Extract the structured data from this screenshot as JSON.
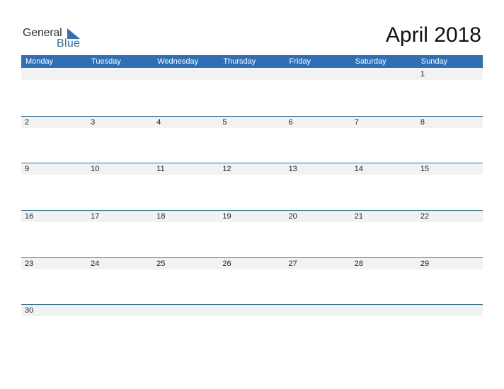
{
  "logo": {
    "word1": "General",
    "word2": "Blue"
  },
  "title": "April 2018",
  "colors": {
    "accent": "#2E6FB5",
    "strip": "#f2f2f2"
  },
  "weekdays": [
    "Monday",
    "Tuesday",
    "Wednesday",
    "Thursday",
    "Friday",
    "Saturday",
    "Sunday"
  ],
  "weeks": [
    [
      "",
      "",
      "",
      "",
      "",
      "",
      "1"
    ],
    [
      "2",
      "3",
      "4",
      "5",
      "6",
      "7",
      "8"
    ],
    [
      "9",
      "10",
      "11",
      "12",
      "13",
      "14",
      "15"
    ],
    [
      "16",
      "17",
      "18",
      "19",
      "20",
      "21",
      "22"
    ],
    [
      "23",
      "24",
      "25",
      "26",
      "27",
      "28",
      "29"
    ],
    [
      "30",
      "",
      "",
      "",
      "",
      "",
      ""
    ]
  ]
}
